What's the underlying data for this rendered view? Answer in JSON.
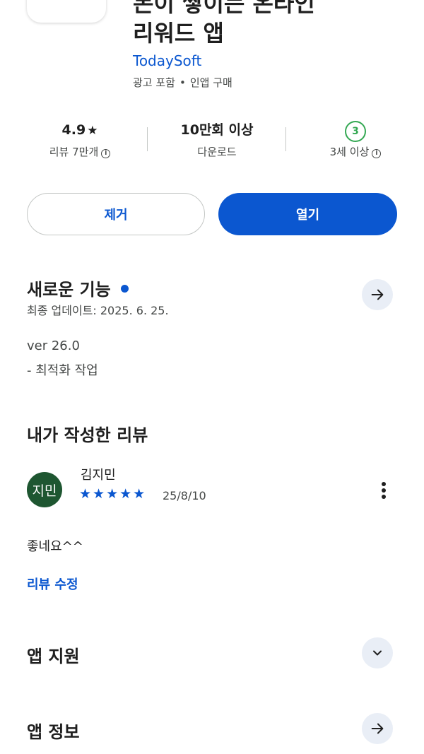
{
  "app": {
    "title_line1": "돈이 쌓이는 온라인",
    "title_line2": "리워드 앱",
    "developer": "TodaySoft",
    "meta_ads": "광고 포함",
    "meta_sep": "•",
    "meta_iap": "인앱 구매"
  },
  "stats": {
    "rating": "4.9",
    "rating_star": "★",
    "reviews": "리뷰 7만개",
    "downloads": "10만회 이상",
    "downloads_label": "다운로드",
    "age_badge": "3",
    "age_label": "3세 이상"
  },
  "buttons": {
    "remove": "제거",
    "open": "열기"
  },
  "whats_new": {
    "title": "새로운 기능",
    "updated": "최종 업데이트: 2025. 6. 25.",
    "version": "ver 26.0",
    "note": "- 최적화 작업"
  },
  "my_review": {
    "section_title": "내가 작성한 리뷰",
    "avatar_text": "지민",
    "author": "김지민",
    "rating": 5,
    "stars": "★★★★★",
    "date": "25/8/10",
    "text": "좋네요^^",
    "edit_link": "리뷰 수정"
  },
  "app_support": {
    "title": "앱 지원"
  },
  "app_info": {
    "title": "앱 정보"
  },
  "colors": {
    "accent": "#0b57d0",
    "avatar_bg": "#1e5631",
    "age_green": "#34a853",
    "circle_bg": "#e9eef6"
  }
}
